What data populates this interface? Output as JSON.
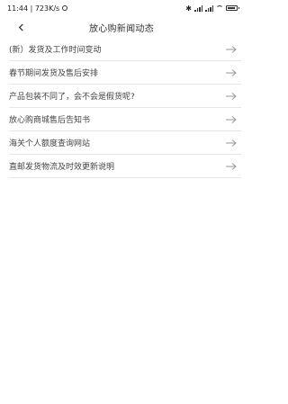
{
  "status_bar": {
    "time_speed": "11:44 | 723K/s",
    "battery_level": 0.85
  },
  "nav": {
    "title": "放心购新闻动态"
  },
  "news_items": [
    {
      "label": "(新）发货及工作时间变动"
    },
    {
      "label": "春节期间发货及售后安排"
    },
    {
      "label": "产品包装不同了，会不会是假货呢?"
    },
    {
      "label": "放心购商城售后告知书"
    },
    {
      "label": "海关个人额度查询网站"
    },
    {
      "label": "直邮发货物流及时效更新说明"
    }
  ]
}
